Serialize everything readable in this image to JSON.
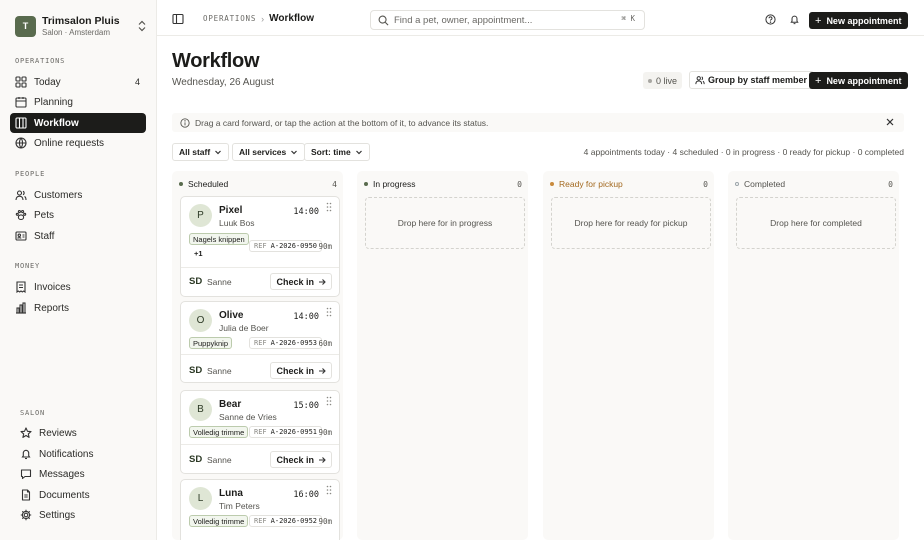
{
  "brand": {
    "avatar": "T",
    "name": "Trimsalon Pluis",
    "subtitle": "Salon · Amsterdam"
  },
  "sidebar": {
    "sections": [
      {
        "label": "OPERATIONS",
        "items": [
          {
            "label": "Today",
            "icon": "grid-icon",
            "count": "4"
          },
          {
            "label": "Planning",
            "icon": "calendar-icon"
          },
          {
            "label": "Workflow",
            "icon": "board-icon",
            "active": true
          },
          {
            "label": "Online requests",
            "icon": "globe-icon"
          }
        ]
      },
      {
        "label": "PEOPLE",
        "items": [
          {
            "label": "Customers",
            "icon": "users-icon"
          },
          {
            "label": "Pets",
            "icon": "paw-icon"
          },
          {
            "label": "Staff",
            "icon": "id-card-icon"
          }
        ]
      },
      {
        "label": "MONEY",
        "items": [
          {
            "label": "Invoices",
            "icon": "receipt-icon"
          },
          {
            "label": "Reports",
            "icon": "chart-icon"
          }
        ]
      },
      {
        "label": "SALON",
        "items": [
          {
            "label": "Reviews",
            "icon": "star-icon"
          },
          {
            "label": "Notifications",
            "icon": "bell-icon"
          },
          {
            "label": "Messages",
            "icon": "message-icon"
          },
          {
            "label": "Documents",
            "icon": "document-icon"
          },
          {
            "label": "Settings",
            "icon": "gear-icon"
          }
        ]
      }
    ]
  },
  "topbar": {
    "breadcrumb_section": "OPERATIONS",
    "breadcrumb_sep": "›",
    "breadcrumb_page": "Workflow",
    "search_placeholder": "Find a pet, owner, appointment...",
    "search_shortcut": "⌘ K",
    "new_appointment": "New appointment"
  },
  "header": {
    "title": "Workflow",
    "date": "Wednesday, 26 August",
    "live": "0 live",
    "group_by": "Group by staff member",
    "new_appointment": "New appointment"
  },
  "banner": {
    "text": "Drag a card forward, or tap the action at the bottom of it, to advance its status."
  },
  "filters": {
    "staff": "All staff",
    "services": "All services",
    "sort": "Sort: time"
  },
  "summary": "4 appointments today · 4 scheduled · 0 in progress · 0 ready for pickup · 0 completed",
  "columns": [
    {
      "label": "Scheduled",
      "count": "4",
      "dot": "#596b4e"
    },
    {
      "label": "In progress",
      "count": "0",
      "dot": "#596b4e",
      "drop": "Drop here for in progress"
    },
    {
      "label": "Ready for pickup",
      "count": "0",
      "dot": "#c98a3d",
      "drop": "Drop here for ready for pickup"
    },
    {
      "label": "Completed",
      "count": "0",
      "dot": "#9aa3a8",
      "drop": "Drop here for completed"
    }
  ],
  "cards": [
    {
      "initial": "P",
      "pet": "Pixel",
      "owner": "Luuk Bos",
      "time": "14:00",
      "service": "Nagels knippen",
      "extra": "+1",
      "ref_label": "REF",
      "ref": "A-2026-0950",
      "duration": "90m",
      "staff_initials": "SD",
      "staff": "Sanne",
      "action": "Check in"
    },
    {
      "initial": "O",
      "pet": "Olive",
      "owner": "Julia de Boer",
      "time": "14:00",
      "service": "Puppyknip",
      "ref_label": "REF",
      "ref": "A-2026-0953",
      "duration": "60m",
      "staff_initials": "SD",
      "staff": "Sanne",
      "action": "Check in"
    },
    {
      "initial": "B",
      "pet": "Bear",
      "owner": "Sanne de Vries",
      "time": "15:00",
      "service": "Volledig trimme",
      "ref_label": "REF",
      "ref": "A-2026-0951",
      "duration": "90m",
      "staff_initials": "SD",
      "staff": "Sanne",
      "action": "Check in"
    },
    {
      "initial": "L",
      "pet": "Luna",
      "owner": "Tim Peters",
      "time": "16:00",
      "service": "Volledig trimme",
      "ref_label": "REF",
      "ref": "A-2026-0952",
      "duration": "90m"
    }
  ],
  "colors": {
    "accent": "#1c1c1a",
    "avatar": "#596b4e",
    "pet_avatar_bg": "#dfe6d5",
    "tag_border": "#bccbad",
    "sidebar_bg": "#faf9f7"
  }
}
